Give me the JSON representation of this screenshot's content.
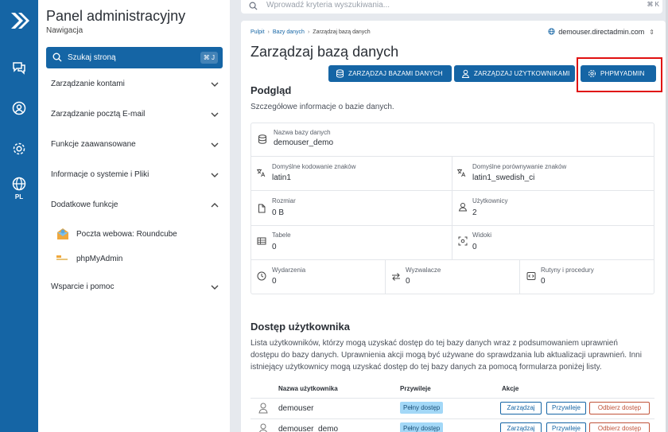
{
  "rail": {
    "lang": "PL"
  },
  "sidebar": {
    "title": "Panel administracyjny",
    "subtitle": "Nawigacja",
    "search_label": "Szukaj stroną",
    "search_kbd": "⌘ J",
    "items": [
      {
        "label": "Zarządzanie kontami"
      },
      {
        "label": "Zarządzanie pocztą E-mail"
      },
      {
        "label": "Funkcje zaawansowane"
      },
      {
        "label": "Informacje o systemie i Pliki"
      },
      {
        "label": "Dodatkowe funkcje"
      },
      {
        "label": "Wsparcie i pomoc"
      }
    ],
    "sub_items": [
      {
        "label": "Poczta webowa: Roundcube"
      },
      {
        "label": "phpMyAdmin"
      }
    ]
  },
  "topbar": {
    "placeholder": "Wprowadź kryteria wyszukiwania...",
    "kbd": "⌘ K"
  },
  "breadcrumb": {
    "items": [
      "Pulpit",
      "Bazy danych"
    ],
    "current": "Zarządzaj bazą danych"
  },
  "domain": "demouser.directadmin.com",
  "page_title": "Zarządzaj bazą danych",
  "actions": {
    "manage_db": "ZARZĄDZAJ BAZAMI DANYCH",
    "manage_users": "ZARZĄDZAJ UŻYTKOWNIKAMI",
    "phpmyadmin": "PHPMYADMIN"
  },
  "overview": {
    "heading": "Podgląd",
    "description": "Szczegółowe informacje o bazie danych.",
    "db_name_label": "Nazwa bazy danych",
    "db_name": "demouser_demo",
    "charset_label": "Domyślne kodowanie znaków",
    "charset": "latin1",
    "collation_label": "Domyślne porównywanie znaków",
    "collation": "latin1_swedish_ci",
    "size_label": "Rozmiar",
    "size": "0 B",
    "users_label": "Użytkownicy",
    "users": "2",
    "tables_label": "Tabele",
    "tables": "0",
    "views_label": "Widoki",
    "views": "0",
    "events_label": "Wydarzenia",
    "events": "0",
    "triggers_label": "Wyzwalacze",
    "triggers": "0",
    "routines_label": "Rutyny i procedury",
    "routines": "0"
  },
  "access": {
    "heading": "Dostęp użytkownika",
    "description": "Lista użytkowników, którzy mogą uzyskać dostęp do tej bazy danych wraz z podsumowaniem uprawnień dostępu do bazy danych. Uprawnienia akcji mogą być używane do sprawdzania lub aktualizacji uprawnień. Inni istniejący użytkownicy mogą uzyskać dostęp do tej bazy danych za pomocą formularza poniżej listy.",
    "columns": [
      "Nazwa użytkownika",
      "Przywileje",
      "Akcje"
    ],
    "rows": [
      {
        "name": "demouser",
        "privileges": "Pełny dostęp"
      },
      {
        "name": "demouser_demo",
        "privileges": "Pełny dostęp"
      }
    ],
    "btn_manage": "Zarządzaj",
    "btn_privileges": "Przywileje",
    "btn_revoke": "Odbierz dostęp"
  }
}
